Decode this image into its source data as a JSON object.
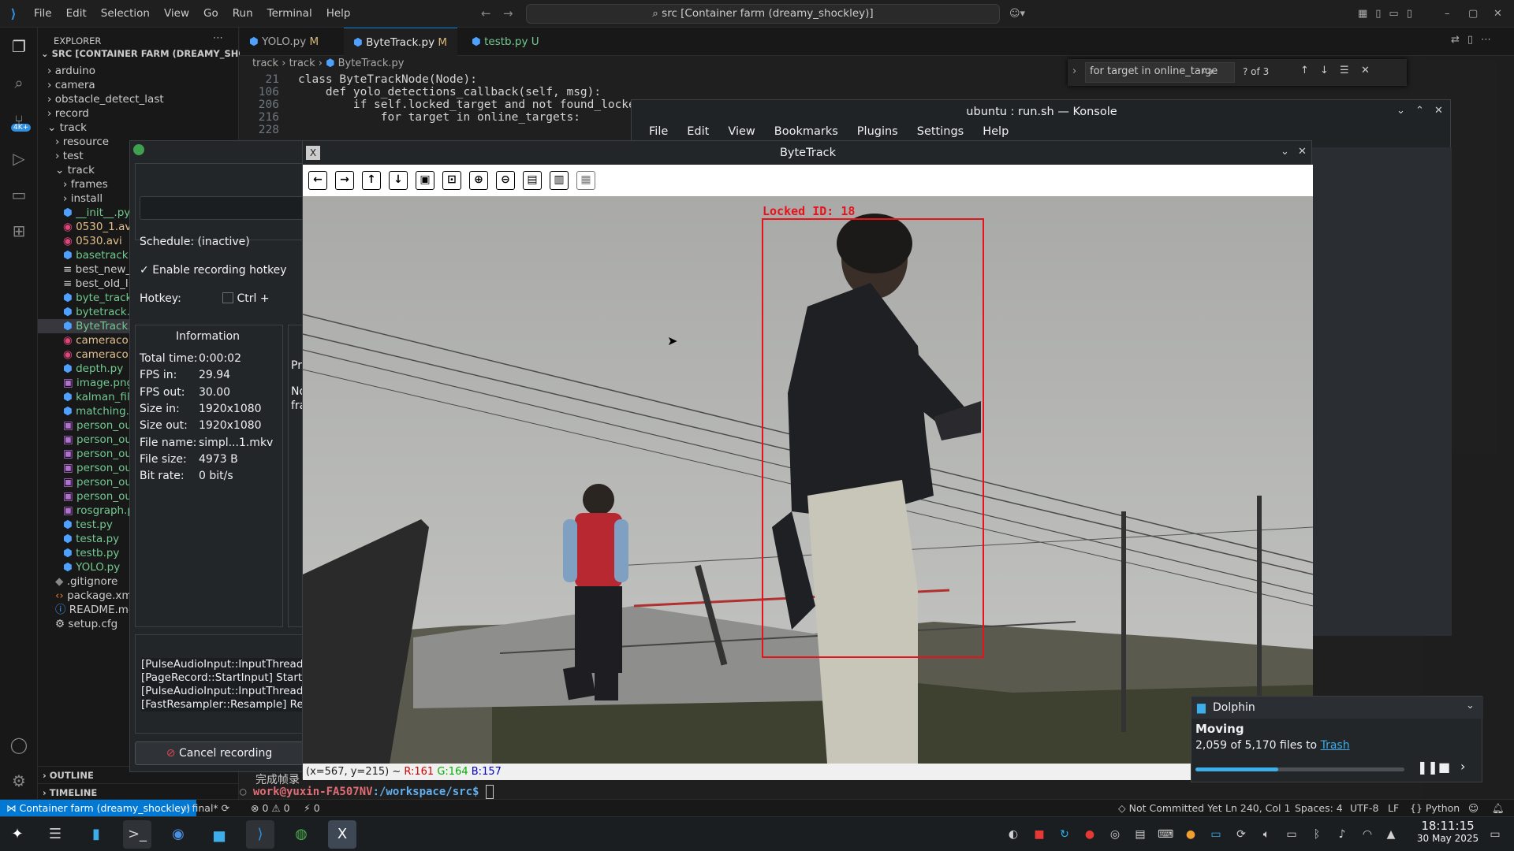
{
  "vscode": {
    "menu": [
      "File",
      "Edit",
      "Selection",
      "View",
      "Go",
      "Run",
      "Terminal",
      "Help"
    ],
    "command_center": "src [Container farm (dreamy_shockley)]",
    "explorer_title": "EXPLORER",
    "root": "SRC [CONTAINER FARM (DREAMY_SHOCK...",
    "tree": [
      {
        "label": "arduino",
        "type": "folder",
        "indent": 0
      },
      {
        "label": "camera",
        "type": "folder",
        "indent": 0
      },
      {
        "label": "obstacle_detect_last",
        "type": "folder",
        "indent": 0
      },
      {
        "label": "record",
        "type": "folder",
        "indent": 0
      },
      {
        "label": "track",
        "type": "folder-open",
        "indent": 0
      },
      {
        "label": "resource",
        "type": "folder",
        "indent": 1
      },
      {
        "label": "test",
        "type": "folder",
        "indent": 1
      },
      {
        "label": "track",
        "type": "folder-open",
        "indent": 1
      },
      {
        "label": "frames",
        "type": "folder",
        "indent": 2
      },
      {
        "label": "install",
        "type": "folder",
        "indent": 2
      },
      {
        "label": "__init__.py",
        "type": "py",
        "indent": 2
      },
      {
        "label": "0530_1.avi",
        "type": "avi",
        "indent": 2
      },
      {
        "label": "0530.avi",
        "type": "avi",
        "indent": 2
      },
      {
        "label": "basetrack.",
        "type": "py",
        "indent": 2
      },
      {
        "label": "best_new_",
        "type": "txt",
        "indent": 2
      },
      {
        "label": "best_old_l.",
        "type": "txt",
        "indent": 2
      },
      {
        "label": "byte_track",
        "type": "py",
        "indent": 2
      },
      {
        "label": "bytetrack.p",
        "type": "py",
        "indent": 2
      },
      {
        "label": "ByteTrack.",
        "type": "py",
        "indent": 2
      },
      {
        "label": "cameracol",
        "type": "avi",
        "indent": 2
      },
      {
        "label": "cameracol",
        "type": "avi",
        "indent": 2
      },
      {
        "label": "depth.py",
        "type": "py",
        "indent": 2
      },
      {
        "label": "image.png",
        "type": "png",
        "indent": 2
      },
      {
        "label": "kalman_filt",
        "type": "py",
        "indent": 2
      },
      {
        "label": "matching.p",
        "type": "py",
        "indent": 2
      },
      {
        "label": "person_ou",
        "type": "img",
        "indent": 2
      },
      {
        "label": "person_ou",
        "type": "img",
        "indent": 2
      },
      {
        "label": "person_ou",
        "type": "img",
        "indent": 2
      },
      {
        "label": "person_ou",
        "type": "img",
        "indent": 2
      },
      {
        "label": "person_ou",
        "type": "img",
        "indent": 2
      },
      {
        "label": "person_ou",
        "type": "img",
        "indent": 2
      },
      {
        "label": "rosgraph.p",
        "type": "img",
        "indent": 2
      },
      {
        "label": "test.py",
        "type": "py",
        "indent": 2
      },
      {
        "label": "testa.py",
        "type": "py",
        "indent": 2
      },
      {
        "label": "testb.py",
        "type": "py",
        "indent": 2
      },
      {
        "label": "YOLO.py",
        "type": "py",
        "indent": 2
      },
      {
        "label": ".gitignore",
        "type": "git",
        "indent": 1
      },
      {
        "label": "package.xm",
        "type": "xml",
        "indent": 1
      },
      {
        "label": "README.mc",
        "type": "md",
        "indent": 1
      },
      {
        "label": "setup.cfg",
        "type": "cfg",
        "indent": 1
      }
    ],
    "outline": "OUTLINE",
    "timeline": "TIMELINE",
    "tabs": [
      {
        "label": "YOLO.py",
        "badge": "M"
      },
      {
        "label": "ByteTrack.py",
        "badge": "M"
      },
      {
        "label": "testb.py",
        "badge": "U"
      }
    ],
    "breadcrumb": [
      "track",
      "track",
      "ByteTrack.py"
    ],
    "code": [
      {
        "num": "21",
        "text": "class ByteTrackNode(Node):"
      },
      {
        "num": "106",
        "text": "    def yolo_detections_callback(self, msg):"
      },
      {
        "num": "206",
        "text": "        if self.locked_target and not found_locked_"
      },
      {
        "num": "216",
        "text": "            for target in online_targets:"
      },
      {
        "num": "228",
        "text": ""
      }
    ],
    "find": {
      "query": "for target in online_targe",
      "count": "? of 3"
    },
    "terminal_chinese": "完成帧录",
    "terminal_prompt_user": "work@yuxin-FA507NV",
    "terminal_prompt_path": ":/workspace/src$",
    "status": {
      "remote": "Container farm (dreamy_shockley)",
      "branch": "final*",
      "errors": "0",
      "warnings": "0",
      "ports": "0",
      "commit": "Not Committed Yet",
      "cursor": "Ln 240, Col 1",
      "spaces": "Spaces: 4",
      "encoding": "UTF-8",
      "eol": "LF",
      "language": "Python"
    }
  },
  "konsole": {
    "title": "ubuntu : run.sh — Konsole",
    "menu": [
      "File",
      "Edit",
      "View",
      "Bookmarks",
      "Plugins",
      "Settings",
      "Help"
    ]
  },
  "bytetrack": {
    "title": "ByteTrack",
    "locked_label": "Locked ID: 18",
    "status": {
      "coords": "(x=567, y=215) ~",
      "r": "R:161",
      "g": "G:164",
      "b": "B:157"
    }
  },
  "ssr": {
    "schedule": "Schedule: (inactive)",
    "enable_hotkey": "Enable recording hotkey",
    "hotkey_label": "Hotkey:",
    "hotkey_value": "Ctrl +",
    "info_title": "Information",
    "info": [
      {
        "k": "Total time:",
        "v": "0:00:02"
      },
      {
        "k": "FPS in:",
        "v": "29.94"
      },
      {
        "k": "FPS out:",
        "v": "30.00"
      },
      {
        "k": "Size in:",
        "v": "1920x1080"
      },
      {
        "k": "Size out:",
        "v": "1920x1080"
      },
      {
        "k": "File name:",
        "v": "simpl...1.mkv"
      },
      {
        "k": "File size:",
        "v": "4973 B"
      },
      {
        "k": "Bit rate:",
        "v": "0 bit/s"
      }
    ],
    "side_text": [
      "Pr",
      "No",
      "fra"
    ],
    "log": [
      "[PulseAudioInput::InputThread",
      "[PageRecord::StartInput] Starte",
      "[PulseAudioInput::InputThread",
      "[FastResampler::Resample] Res"
    ],
    "cancel": "Cancel recording"
  },
  "dolphin": {
    "app": "Dolphin",
    "title": "Moving",
    "detail": "2,059 of 5,170 files to",
    "link": "Trash",
    "progress": 0.398
  },
  "taskbar": {
    "time": "18:11:15",
    "date": "30 May 2025"
  }
}
